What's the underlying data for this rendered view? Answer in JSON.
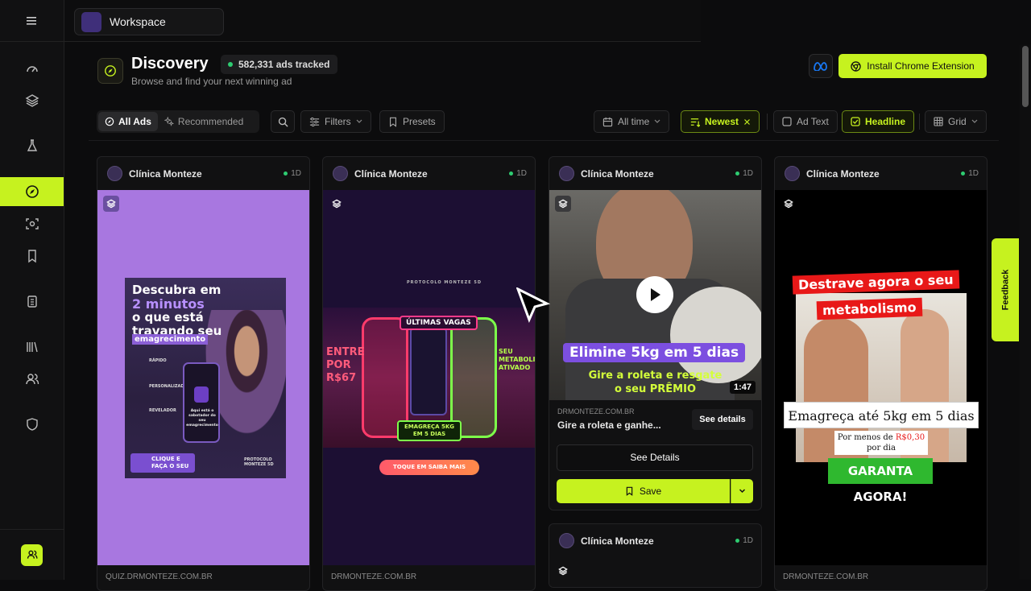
{
  "workspace": {
    "name": "Workspace"
  },
  "header": {
    "title": "Discovery",
    "badge": "582,331 ads tracked",
    "subtitle": "Browse and find your next winning ad",
    "install_label": "Install Chrome Extension"
  },
  "toolbar": {
    "all_ads": "All Ads",
    "recommended": "Recommended",
    "filters": "Filters",
    "presets": "Presets",
    "time": "All time",
    "sort": "Newest",
    "ad_text": "Ad Text",
    "headline": "Headline",
    "view": "Grid"
  },
  "feedback": "Feedback",
  "cards": [
    {
      "advertiser": "Clínica Monteze",
      "age": "1D",
      "domain": "QUIZ.DRMONTEZE.COM.BR",
      "creative": {
        "line1": "Descubra em",
        "line2": "2 minutos",
        "line3": "o que está",
        "line4": "travando seu",
        "line5": "emagrecimento",
        "bullet1": "RÁPIDO",
        "bullet2": "PERSONALIZADO",
        "bullet3": "REVELADOR",
        "phone_text": "Aqui está o sabotador do seu emagrecimento",
        "cta": "CLIQUE E FAÇA O SEU",
        "brand": "PROTOCOLO MONTEZE 5D"
      }
    },
    {
      "advertiser": "Clínica Monteze",
      "age": "1D",
      "domain": "DRMONTEZE.COM.BR",
      "creative": {
        "brand": "PROTOCOLO MONTEZE 5D",
        "top": "ÚLTIMAS VAGAS",
        "left": "ENTRE POR R$67",
        "right": "SEU METABOLISMO ATIVADO",
        "bottom": "EMAGREÇA 5KG EM 5 DIAS",
        "cta": "TOQUE EM SAIBA MAIS"
      }
    },
    {
      "advertiser": "Clínica Monteze",
      "age": "1D",
      "domain": "DRMONTEZE.COM.BR",
      "headline": "Gire a roleta e ganhe...",
      "see_details_small": "See details",
      "see_details": "See Details",
      "save": "Save",
      "duration": "1:47",
      "creative": {
        "line1": "Elimine 5kg em 5 dias",
        "line2": "Gire a roleta e resgate",
        "line3": "o seu PRÊMIO"
      }
    },
    {
      "advertiser": "Clínica Monteze",
      "age": "1D",
      "domain": "DRMONTEZE.COM.BR",
      "creative": {
        "top1": "Destrave agora o seu",
        "top2": "metabolismo",
        "mid": "Emagreça até 5kg em 5 dias",
        "price1": "Por menos de ",
        "price_hl": "R$0,30",
        "price2": "por dia",
        "cta": "GARANTA AGORA!"
      }
    },
    {
      "advertiser": "Clínica Monteze",
      "age": "1D"
    }
  ],
  "colors": {
    "accent": "#c6f21f",
    "bg": "#0c0c0d",
    "card": "#111112"
  }
}
